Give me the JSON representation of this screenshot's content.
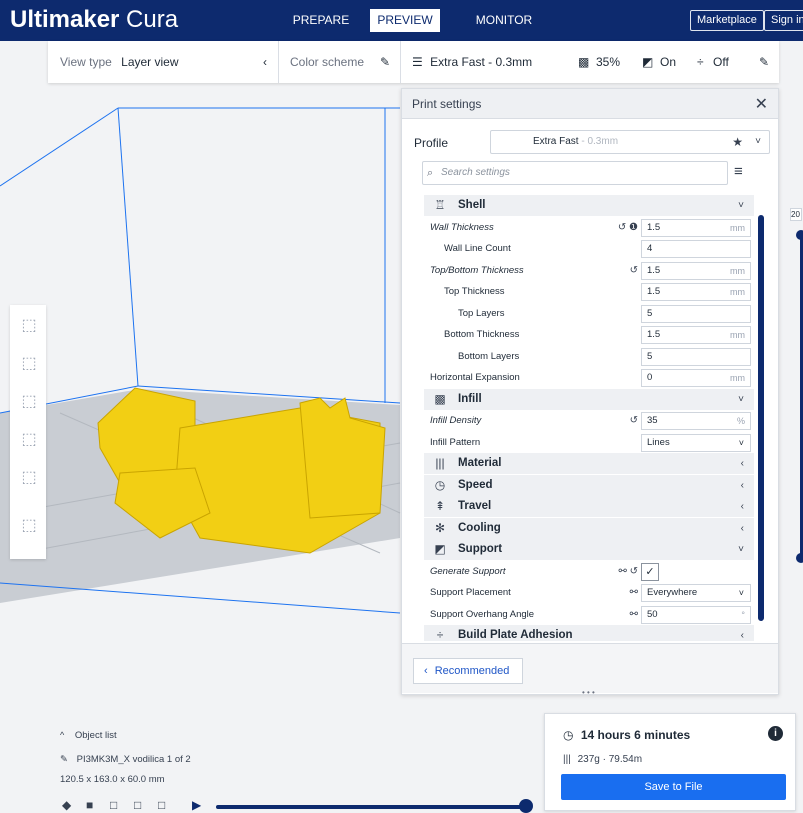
{
  "app": {
    "logo_bold": "Ultimaker",
    "logo_light": " Cura"
  },
  "stages": [
    {
      "label": "PREPARE"
    },
    {
      "label": "PREVIEW"
    },
    {
      "label": "MONITOR"
    }
  ],
  "header_buttons": {
    "marketplace": "Marketplace",
    "signin": "Sign in"
  },
  "toolbar": {
    "view_type_label": "View type",
    "view_type_value": "Layer view",
    "color_scheme_label": "Color scheme",
    "profile_summary": "Extra Fast - 0.3mm",
    "infill_summary": "35%",
    "support_summary": "On",
    "adhesion_summary": "Off"
  },
  "print_settings": {
    "title": "Print settings",
    "profile_label": "Profile",
    "profile_name": "Extra Fast",
    "profile_detail": " - 0.3mm",
    "search_placeholder": "Search settings"
  },
  "settings_rows": [
    {
      "kind": "cat",
      "label": "Shell",
      "icon": "shell-icon",
      "glyph": "♖",
      "chev": "˅"
    },
    {
      "kind": "field",
      "label": "Wall Thickness",
      "italic": true,
      "indent": 0,
      "value": "1.5",
      "unit": "mm",
      "controls": "↺ ❶"
    },
    {
      "kind": "field",
      "label": "Wall Line Count",
      "italic": false,
      "indent": 14,
      "value": "4",
      "unit": "",
      "controls": ""
    },
    {
      "kind": "field",
      "label": "Top/Bottom Thickness",
      "italic": true,
      "indent": 0,
      "value": "1.5",
      "unit": "mm",
      "controls": "↺"
    },
    {
      "kind": "field",
      "label": "Top Thickness",
      "italic": false,
      "indent": 14,
      "value": "1.5",
      "unit": "mm",
      "controls": ""
    },
    {
      "kind": "field",
      "label": "Top Layers",
      "italic": false,
      "indent": 28,
      "value": "5",
      "unit": "",
      "controls": ""
    },
    {
      "kind": "field",
      "label": "Bottom Thickness",
      "italic": false,
      "indent": 14,
      "value": "1.5",
      "unit": "mm",
      "controls": ""
    },
    {
      "kind": "field",
      "label": "Bottom Layers",
      "italic": false,
      "indent": 28,
      "value": "5",
      "unit": "",
      "controls": ""
    },
    {
      "kind": "field",
      "label": "Horizontal Expansion",
      "italic": false,
      "indent": 0,
      "value": "0",
      "unit": "mm",
      "controls": ""
    },
    {
      "kind": "cat",
      "label": "Infill",
      "icon": "infill-icon",
      "glyph": "▩",
      "chev": "˅"
    },
    {
      "kind": "field",
      "label": "Infill Density",
      "italic": true,
      "indent": 0,
      "value": "35",
      "unit": "%",
      "controls": "↺"
    },
    {
      "kind": "select",
      "label": "Infill Pattern",
      "italic": false,
      "indent": 0,
      "value": "Lines",
      "controls": ""
    },
    {
      "kind": "cat",
      "label": "Material",
      "icon": "material-icon",
      "glyph": "|||",
      "chev": "‹"
    },
    {
      "kind": "cat",
      "label": "Speed",
      "icon": "speed-icon",
      "glyph": "◷",
      "chev": "‹"
    },
    {
      "kind": "cat",
      "label": "Travel",
      "icon": "travel-icon",
      "glyph": "⇞",
      "chev": "‹"
    },
    {
      "kind": "cat",
      "label": "Cooling",
      "icon": "cooling-icon",
      "glyph": "✻",
      "chev": "‹"
    },
    {
      "kind": "cat",
      "label": "Support",
      "icon": "support-icon",
      "glyph": "◩",
      "chev": "˅"
    },
    {
      "kind": "check",
      "label": "Generate Support",
      "italic": true,
      "indent": 0,
      "value": "✓",
      "controls": "⚯ ↺"
    },
    {
      "kind": "select",
      "label": "Support Placement",
      "italic": false,
      "indent": 0,
      "value": "Everywhere",
      "controls": "⚯"
    },
    {
      "kind": "field",
      "label": "Support Overhang Angle",
      "italic": false,
      "indent": 0,
      "value": "50",
      "unit": "°",
      "controls": "⚯"
    },
    {
      "kind": "cat",
      "label": "Build Plate Adhesion",
      "icon": "adhesion-icon",
      "glyph": "÷",
      "chev": "‹"
    }
  ],
  "recommended_button": "Recommended",
  "object_list": {
    "toggle": "Object list",
    "name": "PI3MK3M_X vodilica 1 of 2",
    "dims": "120.5 x 163.0 x 60.0 mm"
  },
  "estimate": {
    "time": "14 hours 6 minutes",
    "material": "237g · 79.54m",
    "save_label": "Save to File"
  },
  "layer_slider": {
    "top_value": "20"
  }
}
